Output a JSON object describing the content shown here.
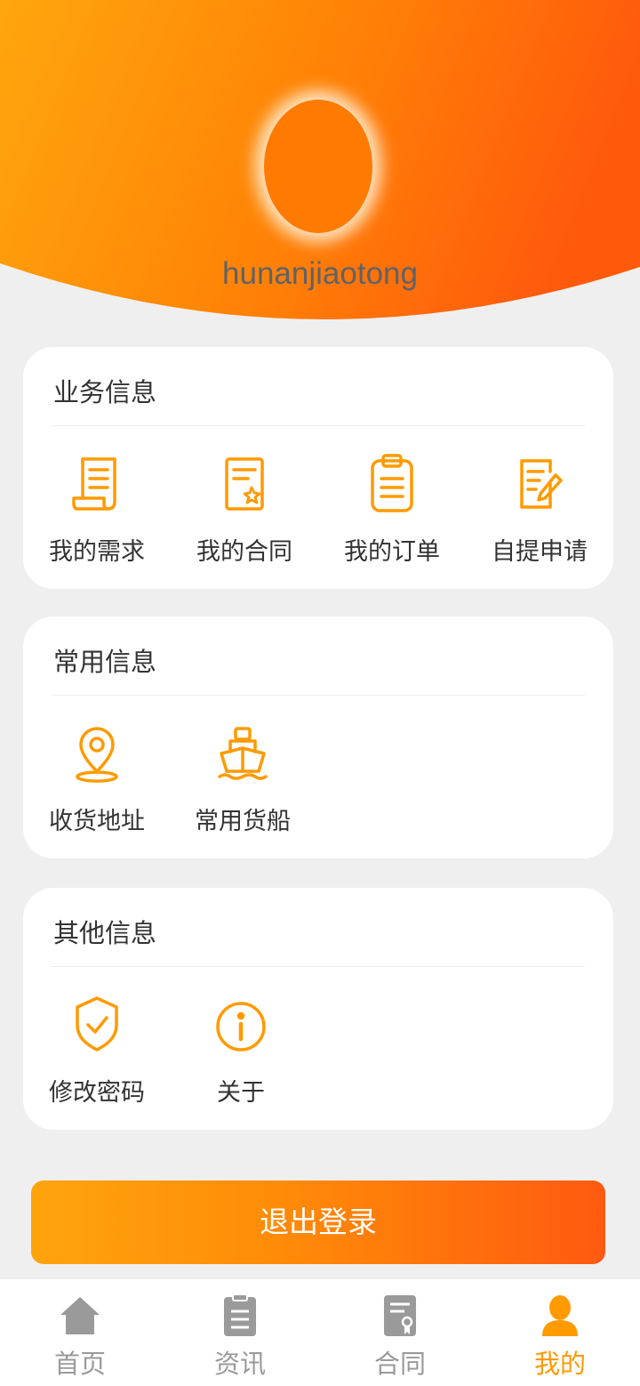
{
  "profile": {
    "username": "hunanjiaotong"
  },
  "sections": [
    {
      "title": "业务信息",
      "items": [
        {
          "label": "我的需求",
          "icon": "scroll-document-icon"
        },
        {
          "label": "我的合同",
          "icon": "contract-document-icon"
        },
        {
          "label": "我的订单",
          "icon": "clipboard-list-icon"
        },
        {
          "label": "自提申请",
          "icon": "edit-document-icon"
        }
      ]
    },
    {
      "title": "常用信息",
      "items": [
        {
          "label": "收货地址",
          "icon": "location-pin-icon"
        },
        {
          "label": "常用货船",
          "icon": "cargo-ship-icon"
        }
      ]
    },
    {
      "title": "其他信息",
      "items": [
        {
          "label": "修改密码",
          "icon": "shield-check-icon"
        },
        {
          "label": "关于",
          "icon": "info-circle-icon"
        }
      ]
    }
  ],
  "logout": {
    "label": "退出登录"
  },
  "tabbar": {
    "tabs": [
      {
        "label": "首页",
        "icon": "home-icon",
        "active": false
      },
      {
        "label": "资讯",
        "icon": "news-clipboard-icon",
        "active": false
      },
      {
        "label": "合同",
        "icon": "contract-icon",
        "active": false
      },
      {
        "label": "我的",
        "icon": "user-icon",
        "active": true
      }
    ]
  },
  "colors": {
    "accent": "#ff9a00",
    "accent_dark": "#ff5a10",
    "inactive": "#9a9a9a",
    "background": "#efefef"
  }
}
